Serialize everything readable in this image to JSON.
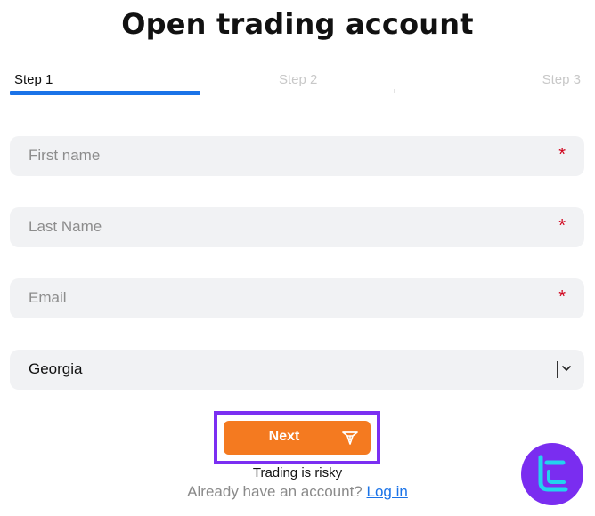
{
  "page": {
    "title": "Open trading account"
  },
  "steps": {
    "items": [
      "Step 1",
      "Step 2",
      "Step 3"
    ],
    "active_index": 0,
    "active_color": "#1a73e8"
  },
  "form": {
    "first_name": {
      "placeholder": "First name",
      "value": "",
      "required_mark": "*"
    },
    "last_name": {
      "placeholder": "Last Name",
      "value": "",
      "required_mark": "*"
    },
    "email": {
      "placeholder": "Email",
      "value": "",
      "required_mark": "*"
    },
    "country": {
      "selected": "Georgia",
      "icon": "chevron-down-icon"
    }
  },
  "actions": {
    "next_label": "Next",
    "next_icon": "brand-logo-icon",
    "button_color": "#f47a20",
    "highlight_color": "#7b2ff2"
  },
  "footer": {
    "risk_text": "Trading is risky",
    "account_prompt": "Already have an account?",
    "login_link": "Log in"
  },
  "badge": {
    "icon": "tradingfinder-logo-icon",
    "color": "#7a2df0"
  }
}
